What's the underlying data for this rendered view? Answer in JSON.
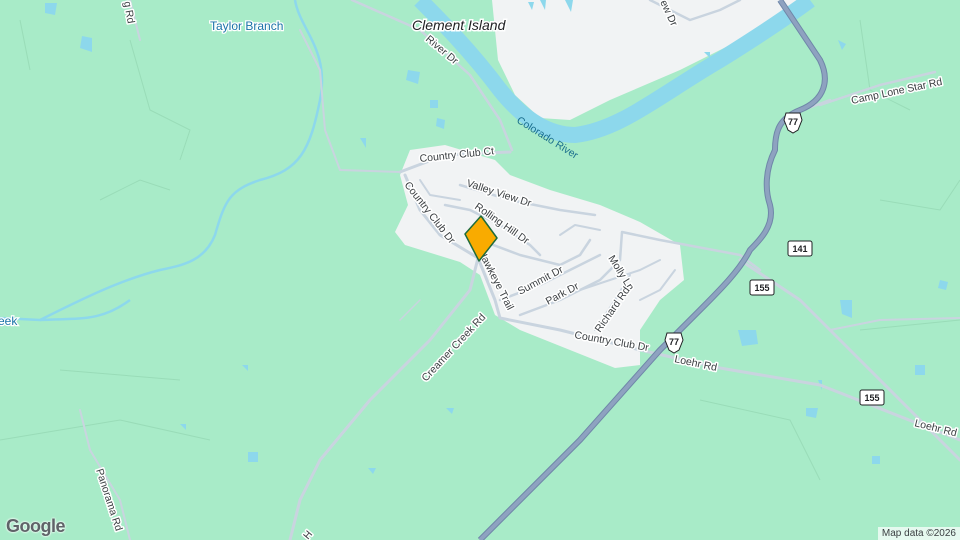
{
  "map": {
    "colors": {
      "land": "#a8ebc8",
      "water": "#8dd8ec",
      "urban": "#f1f3f4",
      "highway": "#7e94b4",
      "road": "#c9d4df",
      "marker": "#f9ab00"
    },
    "places": {
      "island": "Clement Island"
    },
    "water_labels": {
      "creek": "Taylor Branch",
      "river": "Colorado River",
      "creek_partial": "eek"
    },
    "roads": {
      "river_dr": "River Dr",
      "country_club_ct": "Country Club Ct",
      "country_club_dr_west": "Country Club Dr",
      "valley_view_dr": "Valley View Dr",
      "rolling_hill_dr": "Rolling Hill Dr",
      "hawkeye_trail": "Hawkeye Trail",
      "summit_dr": "Summit Dr",
      "park_dr": "Park Dr",
      "molly_ln": "Molly Ln",
      "richard_rd": "Richard Rd",
      "country_club_dr_south": "Country Club Dr",
      "creamer_creek_rd": "Creamer Creek Rd",
      "loehr_rd_1": "Loehr Rd",
      "loehr_rd_2": "Loehr Rd",
      "panorama_rd": "Panorama Rd",
      "camp_lone_star_rd": "Camp Lone Star Rd",
      "top_road_partial": "g Rd",
      "top_right_partial": "ew Dr",
      "bottom_partial": "H"
    },
    "shields": {
      "us77_a": "77",
      "us77_b": "77",
      "tx141": "141",
      "tx155_a": "155",
      "tx155_b": "155"
    },
    "logo": "Google",
    "attribution": "Map data ©2026"
  }
}
